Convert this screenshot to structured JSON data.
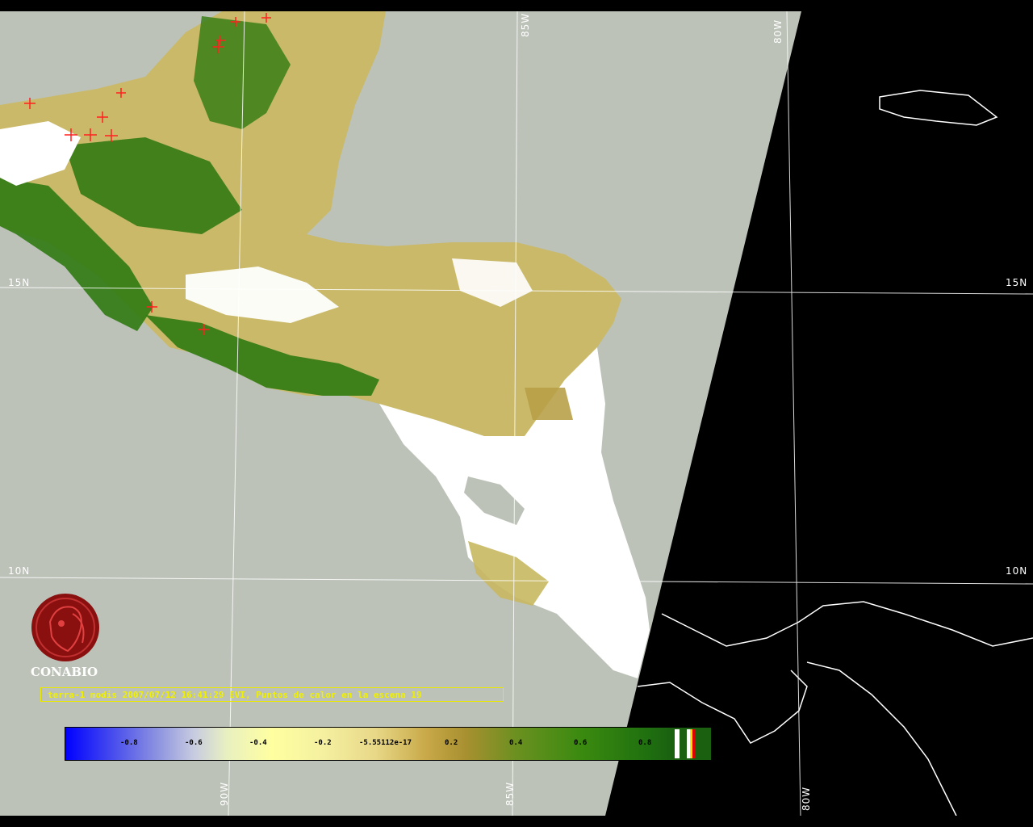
{
  "window": {
    "title": "terra-1 modis 2007/07/12 16:41:29 EVI, Puntos de calor en la escena 19"
  },
  "grid_labels": {
    "lat_15_left": "15N",
    "lat_15_right": "15N",
    "lat_10_left": "10N",
    "lat_10_right": "10N",
    "lon_85_top": "85W",
    "lon_80_top": "80W",
    "lon_90_bottom": "90W",
    "lon_85_bottom": "85W",
    "lon_80_bottom": "80W"
  },
  "caption": "terra-1 modis 2007/07/12 16:41:29 EVI, Puntos de calor en la escena 19",
  "logo": {
    "name": "CONABIO",
    "icon": "conabio-macaw-logo"
  },
  "legend": {
    "ticks": [
      "-0.8",
      "-0.6",
      "-0.4",
      "-0.2",
      "-5.55112e-17",
      "0.2",
      "0.4",
      "0.6",
      "0.8"
    ]
  },
  "colors": {
    "ocean": "#bcc2b8",
    "night": "#000000",
    "vegetation_dark": "#2f7a12",
    "vegetation_light": "#c8b860",
    "cloud": "#ffffff",
    "hotspot": "#ff2020",
    "caption": "#f0f000"
  }
}
